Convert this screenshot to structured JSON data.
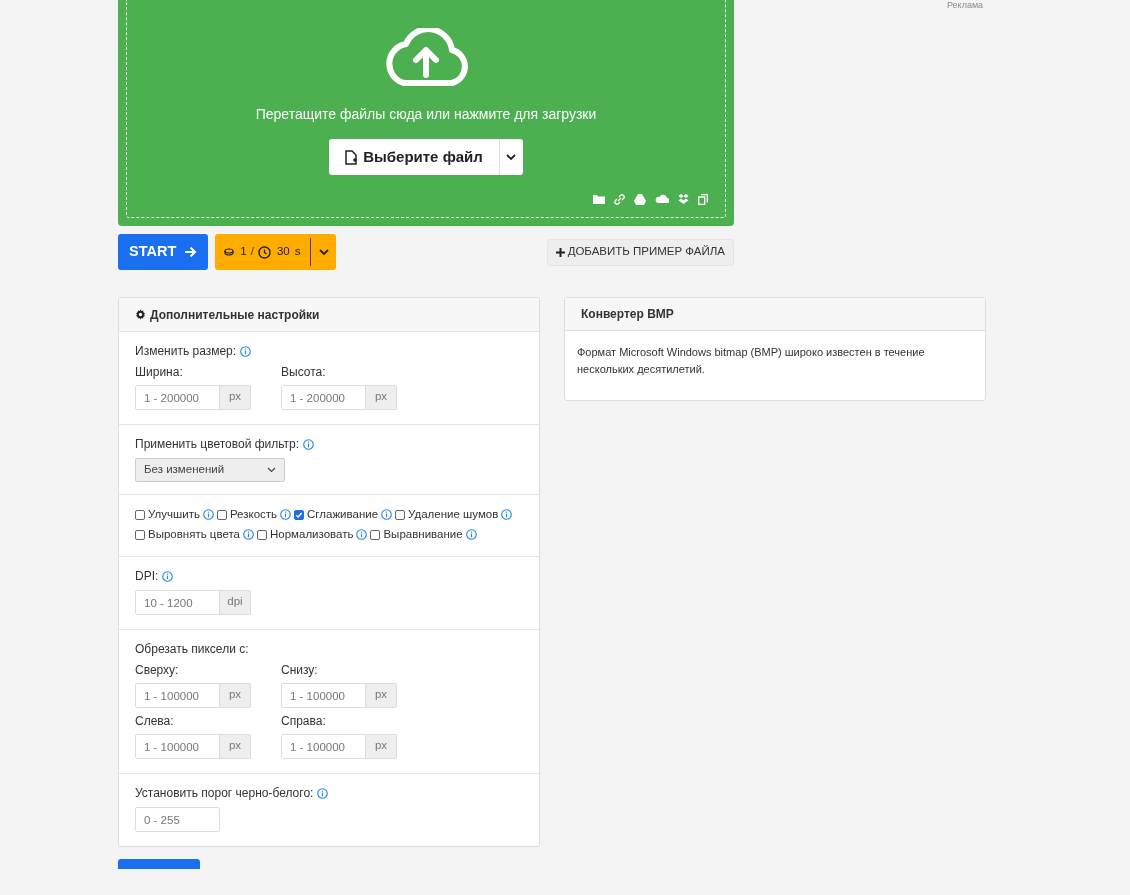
{
  "ad_label": "Реклама",
  "upload": {
    "hint": "Перетащите файлы сюда или нажмите для загрузки",
    "choose_button": "Выберите файл"
  },
  "actions": {
    "start_button": "START",
    "credits": "1",
    "separator": "/",
    "time": "30",
    "time_unit": "s",
    "add_sample_button": "ДОБАВИТЬ ПРИМЕР ФАЙЛА"
  },
  "settings": {
    "title": "Дополнительные настройки",
    "sections": [
      {
        "kind": "fields",
        "label": "Изменить размер:",
        "info": true,
        "fields": [
          {
            "label": "Ширина:",
            "placeholder": "1 - 200000",
            "unit": "px"
          },
          {
            "label": "Высота:",
            "placeholder": "1 - 200000",
            "unit": "px"
          }
        ]
      },
      {
        "kind": "select",
        "label": "Применить цветовой фильтр:",
        "info": true,
        "value": "Без изменений"
      },
      {
        "kind": "checkboxes",
        "items": [
          {
            "label": "Улучшить",
            "checked": false
          },
          {
            "label": "Резкость",
            "checked": false
          },
          {
            "label": "Сглаживание",
            "checked": true
          },
          {
            "label": "Удаление шумов",
            "checked": false
          },
          {
            "label": "Выровнять цвета",
            "checked": false
          },
          {
            "label": "Нормализовать",
            "checked": false
          },
          {
            "label": "Выравнивание",
            "checked": false
          }
        ]
      },
      {
        "kind": "fields",
        "label": "DPI:",
        "info": true,
        "fields": [
          {
            "placeholder": "10 - 1200",
            "unit": "dpi"
          }
        ]
      },
      {
        "kind": "fields",
        "label": "Обрезать пиксели с:",
        "info": false,
        "fields": [
          {
            "label": "Сверху:",
            "placeholder": "1 - 100000",
            "unit": "px"
          },
          {
            "label": "Снизу:",
            "placeholder": "1 - 100000",
            "unit": "px"
          },
          {
            "label": "Слева:",
            "placeholder": "1 - 100000",
            "unit": "px"
          },
          {
            "label": "Справа:",
            "placeholder": "1 - 100000",
            "unit": "px"
          }
        ]
      },
      {
        "kind": "fields",
        "label": "Установить порог черно-белого:",
        "info": true,
        "fields": [
          {
            "placeholder": "0 - 255"
          }
        ]
      }
    ]
  },
  "info_card": {
    "title": "Конвертер BMP",
    "text": "Формат Microsoft Windows bitmap (BMP) широко известен в течение нескольких десятилетий."
  }
}
